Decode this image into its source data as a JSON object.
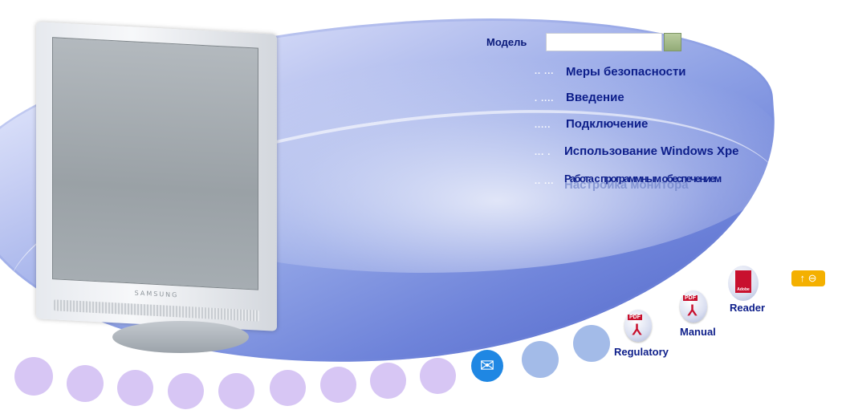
{
  "header": {
    "model_label": "Модель",
    "model_value": ""
  },
  "menu": {
    "items": [
      {
        "label": "Меры безопасности",
        "dots": ".. ..."
      },
      {
        "label": "Введение",
        "dots": ". ...."
      },
      {
        "label": "Подключение",
        "dots": "....."
      },
      {
        "label": "Использование Windows Xpe",
        "dots": "... ."
      },
      {
        "label": "Работа с программным обеспечением",
        "dots": ".. ..."
      }
    ],
    "overlay_label": "Настройка монитора"
  },
  "monitor": {
    "brand": "SAMSUNG"
  },
  "docs": {
    "regulatory_label": "Regulatory",
    "manual_label": "Manual",
    "reader_label": "Reader",
    "pdf_tag": "PDF",
    "adobe_tag": "Adobe"
  },
  "nav": {
    "up_label": "↑ ⊖"
  },
  "colors": {
    "accent": "#0d1e8a",
    "up_button": "#f4b000",
    "mail": "#1f87e3",
    "dot_purple": "#d7c6f4",
    "dot_blue": "#a3bbe8"
  }
}
